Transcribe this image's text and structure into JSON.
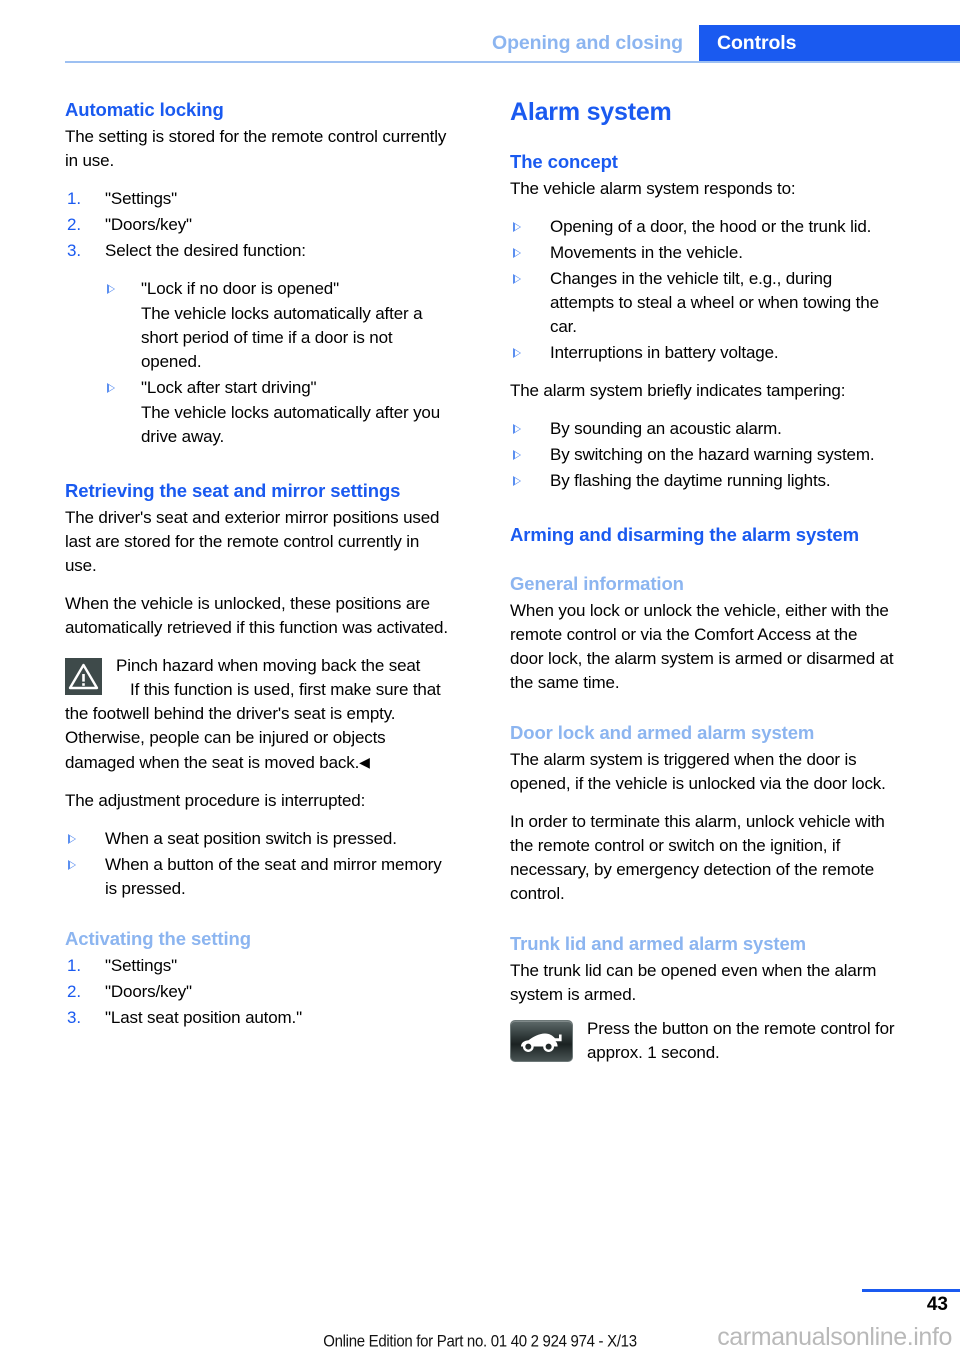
{
  "header": {
    "chapter": "Opening and closing",
    "section": "Controls"
  },
  "left_column": {
    "automatic_locking": {
      "title": "Automatic locking",
      "intro": "The setting is stored for the remote control currently in use.",
      "steps": [
        "\"Settings\"",
        "\"Doors/key\"",
        "Select the desired function:"
      ],
      "options": [
        {
          "label": "\"Lock if no door is opened\"",
          "description": "The vehicle locks automatically after a short period of time if a door is not opened."
        },
        {
          "label": "\"Lock after start driving\"",
          "description": "The vehicle locks automatically after you drive away."
        }
      ]
    },
    "retrieving": {
      "title": "Retrieving the seat and mirror settings",
      "paragraph_1": "The driver's seat and exterior mirror positions used last are stored for the remote control currently in use.",
      "paragraph_2": "When the vehicle is unlocked, these positions are automatically retrieved if this function was activated.",
      "warning": {
        "icon": "warning-triangle-icon",
        "heading": "Pinch hazard when moving back the seat",
        "body": "If this function is used, first make sure that the footwell behind the driver's seat is empty. Otherwise, people can be injured or objects damaged when the seat is moved back.",
        "end_mark": "◀"
      },
      "interrupt_intro": "The adjustment procedure is interrupted:",
      "interrupt_items": [
        "When a seat position switch is pressed.",
        "When a button of the seat and mirror memory is pressed."
      ]
    },
    "activating": {
      "title": "Activating the setting",
      "steps": [
        "\"Settings\"",
        "\"Doors/key\"",
        "\"Last seat position autom.\""
      ]
    }
  },
  "right_column": {
    "alarm_system": {
      "title": "Alarm system",
      "concept": {
        "title": "The concept",
        "intro": "The vehicle alarm system responds to:",
        "responds_items": [
          "Opening of a door, the hood or the trunk lid.",
          "Movements in the vehicle.",
          "Changes in the vehicle tilt, e.g., during attempts to steal a wheel or when towing the car.",
          "Interruptions in battery voltage."
        ],
        "tampering_intro": "The alarm system briefly indicates tampering:",
        "tampering_items": [
          "By sounding an acoustic alarm.",
          "By switching on the hazard warning system.",
          "By flashing the daytime running lights."
        ]
      },
      "arming": {
        "title": "Arming and disarming the alarm system",
        "general": {
          "title": "General information",
          "text": "When you lock or unlock the vehicle, either with the remote control or via the Comfort Access at the door lock, the alarm system is armed or disarmed at the same time."
        },
        "door_lock": {
          "title": "Door lock and armed alarm system",
          "paragraph_1": "The alarm system is triggered when the door is opened, if the vehicle is unlocked via the door lock.",
          "paragraph_2": "In order to terminate this alarm, unlock vehicle with the remote control or switch on the ignition, if necessary, by emergency detection of the remote control."
        },
        "trunk_lid": {
          "title": "Trunk lid and armed alarm system",
          "paragraph_1": "The trunk lid can be opened even when the alarm system is armed.",
          "icon": "car-trunk-open-icon",
          "instruction": "Press the button on the remote control for approx. 1 second."
        }
      }
    }
  },
  "footer": {
    "edition": "Online Edition for Part no. 01 40 2 924 974 - X/13",
    "page_number": "43",
    "watermark": "carmanualsonline.info"
  },
  "colors": {
    "accent_blue": "#1a5af0",
    "light_blue": "#8cb5f0",
    "marker_blue": "#5b8ff0",
    "warning_icon_bg": "#3e4a4a"
  }
}
